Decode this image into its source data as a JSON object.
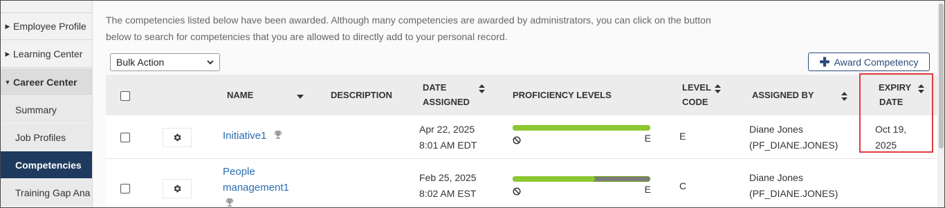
{
  "sidebar": {
    "items": [
      {
        "label": "Employee Profile"
      },
      {
        "label": "Learning Center"
      },
      {
        "label": "Career Center"
      },
      {
        "label": "Summary"
      },
      {
        "label": "Job Profiles"
      },
      {
        "label": "Competencies"
      },
      {
        "label": "Training Gap Ana"
      }
    ]
  },
  "intro": {
    "line1": "The competencies listed below have been awarded. Although many competencies are awarded by administrators, you can click on the button",
    "line2": "below to search for competencies that you are allowed to directly add to your personal record."
  },
  "toolbar": {
    "bulk_action": "Bulk Action",
    "award_label": "Award Competency"
  },
  "table": {
    "headers": {
      "name": "NAME",
      "description": "DESCRIPTION",
      "date_assigned_1": "DATE",
      "date_assigned_2": "ASSIGNED",
      "proficiency": "PROFICIENCY LEVELS",
      "level_code_1": "LEVEL",
      "level_code_2": "CODE",
      "assigned_by": "ASSIGNED BY",
      "expiry_1": "EXPIRY",
      "expiry_2": "DATE"
    },
    "rows": [
      {
        "name_1": "Initiative1",
        "name_2": "",
        "date_1": "Apr 22, 2025",
        "date_2": "8:01 AM EDT",
        "proficiency_fill": 1.0,
        "proficiency_max": "E",
        "level_code": "E",
        "assigned_by_1": "Diane Jones",
        "assigned_by_2": "(PF_DIANE.JONES)",
        "expiry_1": "Oct 19,",
        "expiry_2": "2025"
      },
      {
        "name_1": "People",
        "name_2": "management1",
        "date_1": "Feb 25, 2025",
        "date_2": "8:02 AM EST",
        "proficiency_fill": 0.6,
        "proficiency_max": "E",
        "level_code": "C",
        "assigned_by_1": "Diane Jones",
        "assigned_by_2": "(PF_DIANE.JONES)",
        "expiry_1": "",
        "expiry_2": ""
      }
    ]
  },
  "colors": {
    "accent": "#1f3a5f",
    "link": "#2a6db0",
    "progress": "#8cc832",
    "highlight": "#e0393e"
  },
  "icons": [
    "caret-right-icon",
    "caret-down-icon",
    "plus-icon",
    "sort-icon",
    "gear-icon",
    "trophy-icon",
    "no-level-icon"
  ]
}
